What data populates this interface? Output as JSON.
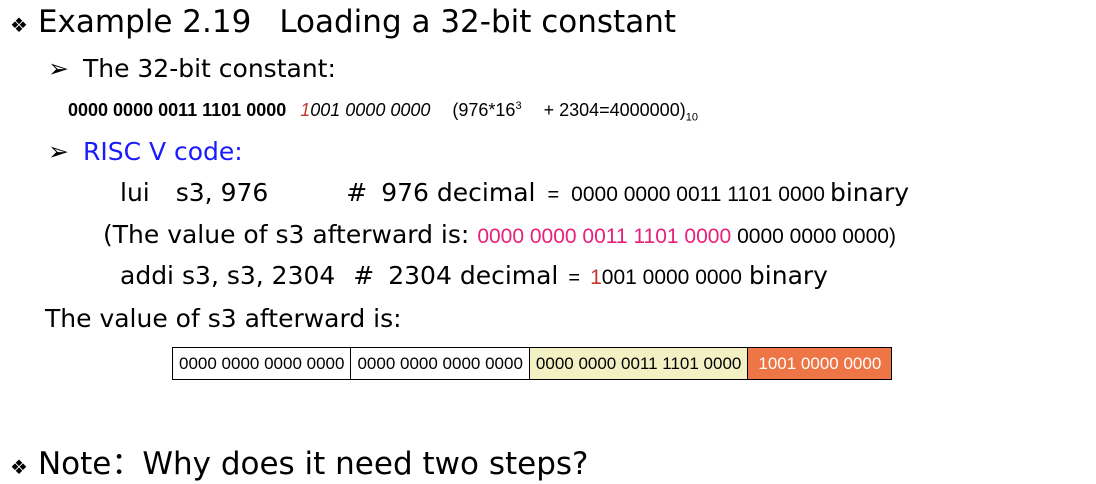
{
  "title": {
    "bullet": "❖",
    "label": "Example 2.19",
    "subtitle": "Loading a 32-bit constant"
  },
  "constant_heading": {
    "arrow": "➢",
    "text": "The 32-bit constant:"
  },
  "constant_line": {
    "bold_part": "0000 0000 0011 1101 0000",
    "red_digit": "1",
    "italic_part": "001 0000 0000",
    "expr_open": "(976*16",
    "expr_exp": "3",
    "expr_rest": "+ 2304=4000000)",
    "expr_base": "10"
  },
  "riscv_heading": {
    "arrow": "➢",
    "text": "RISC V code:"
  },
  "lui_line": {
    "op": "lui",
    "args": "s3, 976",
    "comment_hash": "#",
    "comment_num": "976 decimal",
    "eq": "=",
    "binary": "0000 0000 0011 1101  0000",
    "suffix": "binary"
  },
  "after_lui": {
    "prefix": "(The value of s3 afterward is:",
    "pink_part": "0000 0000 0011 1101  0000",
    "rest": "0000 0000 0000)"
  },
  "addi_line": {
    "op": "addi",
    "args": "s3, s3, 2304",
    "comment_hash": "#",
    "comment_num": "2304 decimal",
    "eq": "=",
    "red_digit": "1",
    "binary_rest": "001 0000 0000",
    "suffix": "binary"
  },
  "final_heading": "The value of s3 afterward is:",
  "register": [
    {
      "value": "0000 0000 0000 0000",
      "color": "#ffffff"
    },
    {
      "value": "0000 0000 0000 0000",
      "color": "#ffffff"
    },
    {
      "value": "0000 0000 0011 1101 0000",
      "color": "#f3f1c4"
    },
    {
      "value": "1001 0000 0000",
      "color": "#ee7646"
    }
  ],
  "note": {
    "bullet": "❖",
    "text": "Note：Why does it need two steps?"
  }
}
